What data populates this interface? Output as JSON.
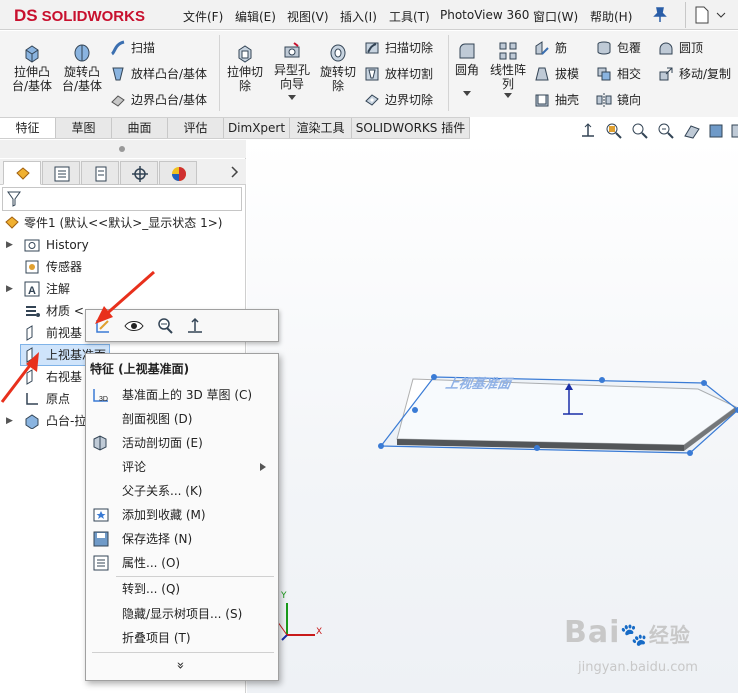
{
  "app": {
    "brand": "SOLIDWORKS",
    "brand_prefix": "DS"
  },
  "menu": [
    "文件(F)",
    "编辑(E)",
    "视图(V)",
    "插入(I)",
    "工具(T)",
    "PhotoView 360",
    "窗口(W)",
    "帮助(H)"
  ],
  "ribbon": {
    "extrude_boss": "拉伸凸\n台/基体",
    "revolve_boss": "旋转凸\n台/基体",
    "sweep": "扫描",
    "loft_boss": "放样凸台/基体",
    "boundary_boss": "边界凸台/基体",
    "extrude_cut": "拉伸切\n除",
    "hole_wizard": "异型孔\n向导",
    "revolve_cut": "旋转切\n除",
    "sweep_cut": "扫描切除",
    "loft_cut": "放样切割",
    "boundary_cut": "边界切除",
    "fillet": "圆角",
    "linear_pattern": "线性阵\n列",
    "rib": "筋",
    "draft": "拔模",
    "shell": "抽壳",
    "wrap": "包覆",
    "intersect": "相交",
    "mirror": "镜向",
    "dome": "圆顶",
    "move_copy": "移动/复制"
  },
  "tabs": [
    "特征",
    "草图",
    "曲面",
    "评估",
    "DimXpert",
    "渲染工具",
    "SOLIDWORKS 插件"
  ],
  "tree": {
    "root": "零件1  (默认<<默认>_显示状态 1>)",
    "items": [
      "History",
      "传感器",
      "注解",
      "材质 <",
      "前视基",
      "上视基准面",
      "右视基",
      "原点",
      "凸台-拉"
    ]
  },
  "context_menu": {
    "title": "特征 (上视基准面)",
    "items": [
      {
        "label": "基准面上的 3D 草图 (C)",
        "icon": "3d-sketch-icon"
      },
      {
        "label": "剖面视图 (D)",
        "icon": ""
      },
      {
        "label": "活动剖切面 (E)",
        "icon": "live-section-icon"
      },
      {
        "label": "评论",
        "icon": "",
        "submenu": true
      },
      {
        "label": "父子关系... (K)",
        "icon": ""
      },
      {
        "label": "添加到收藏 (M)",
        "icon": "favorite-icon"
      },
      {
        "label": "保存选择 (N)",
        "icon": "save-selection-icon"
      },
      {
        "label": "属性... (O)",
        "icon": "properties-icon"
      },
      {
        "label": "转到... (Q)",
        "icon": ""
      },
      {
        "label": "隐藏/显示树项目... (S)",
        "icon": ""
      },
      {
        "label": "折叠项目 (T)",
        "icon": ""
      }
    ],
    "more": "»"
  },
  "viewport": {
    "plane_label": "上视基准面",
    "axis_x": "X",
    "axis_y": "Y"
  },
  "watermark": {
    "line1": "Bai",
    "line2": "经验",
    "url": "jingyan.baidu.com"
  },
  "colors": {
    "brand_red": "#c8102e",
    "arrow_red": "#e8301c",
    "plane_blue": "#3a7bd5"
  }
}
